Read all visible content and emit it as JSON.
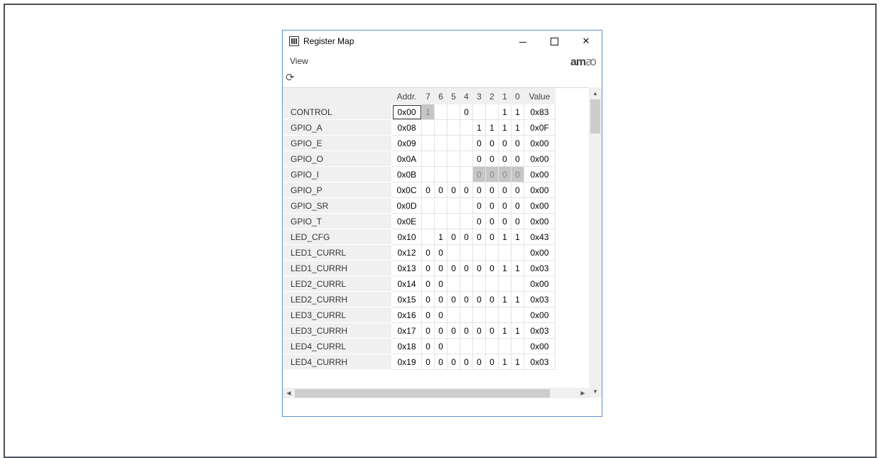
{
  "window": {
    "title": "Register Map",
    "min": "–",
    "max": "□",
    "close": "✕"
  },
  "menu": {
    "view": "View"
  },
  "logo": {
    "main": "am",
    "suffix": "ꜵ"
  },
  "table": {
    "headers": {
      "addr": "Addr.",
      "b7": "7",
      "b6": "6",
      "b5": "5",
      "b4": "4",
      "b3": "3",
      "b2": "2",
      "b1": "1",
      "b0": "0",
      "value": "Value"
    },
    "rows": [
      {
        "name": "CONTROL",
        "addr": "0x00",
        "bits": [
          "1",
          "",
          "",
          "0",
          "",
          "",
          "1",
          "1"
        ],
        "value": "0x83",
        "disabled": [
          0
        ]
      },
      {
        "name": "GPIO_A",
        "addr": "0x08",
        "bits": [
          "",
          "",
          "",
          "",
          "1",
          "1",
          "1",
          "1"
        ],
        "value": "0x0F",
        "disabled": []
      },
      {
        "name": "GPIO_E",
        "addr": "0x09",
        "bits": [
          "",
          "",
          "",
          "",
          "0",
          "0",
          "0",
          "0"
        ],
        "value": "0x00",
        "disabled": []
      },
      {
        "name": "GPIO_O",
        "addr": "0x0A",
        "bits": [
          "",
          "",
          "",
          "",
          "0",
          "0",
          "0",
          "0"
        ],
        "value": "0x00",
        "disabled": []
      },
      {
        "name": "GPIO_I",
        "addr": "0x0B",
        "bits": [
          "",
          "",
          "",
          "",
          "0",
          "0",
          "0",
          "0"
        ],
        "value": "0x00",
        "disabled": [
          4,
          5,
          6,
          7
        ]
      },
      {
        "name": "GPIO_P",
        "addr": "0x0C",
        "bits": [
          "0",
          "0",
          "0",
          "0",
          "0",
          "0",
          "0",
          "0"
        ],
        "value": "0x00",
        "disabled": []
      },
      {
        "name": "GPIO_SR",
        "addr": "0x0D",
        "bits": [
          "",
          "",
          "",
          "",
          "0",
          "0",
          "0",
          "0"
        ],
        "value": "0x00",
        "disabled": []
      },
      {
        "name": "GPIO_T",
        "addr": "0x0E",
        "bits": [
          "",
          "",
          "",
          "",
          "0",
          "0",
          "0",
          "0"
        ],
        "value": "0x00",
        "disabled": []
      },
      {
        "name": "LED_CFG",
        "addr": "0x10",
        "bits": [
          "",
          "1",
          "0",
          "0",
          "0",
          "0",
          "1",
          "1"
        ],
        "value": "0x43",
        "disabled": []
      },
      {
        "name": "LED1_CURRL",
        "addr": "0x12",
        "bits": [
          "0",
          "0",
          "",
          "",
          "",
          "",
          "",
          ""
        ],
        "value": "0x00",
        "disabled": []
      },
      {
        "name": "LED1_CURRH",
        "addr": "0x13",
        "bits": [
          "0",
          "0",
          "0",
          "0",
          "0",
          "0",
          "1",
          "1"
        ],
        "value": "0x03",
        "disabled": []
      },
      {
        "name": "LED2_CURRL",
        "addr": "0x14",
        "bits": [
          "0",
          "0",
          "",
          "",
          "",
          "",
          "",
          ""
        ],
        "value": "0x00",
        "disabled": []
      },
      {
        "name": "LED2_CURRH",
        "addr": "0x15",
        "bits": [
          "0",
          "0",
          "0",
          "0",
          "0",
          "0",
          "1",
          "1"
        ],
        "value": "0x03",
        "disabled": []
      },
      {
        "name": "LED3_CURRL",
        "addr": "0x16",
        "bits": [
          "0",
          "0",
          "",
          "",
          "",
          "",
          "",
          ""
        ],
        "value": "0x00",
        "disabled": []
      },
      {
        "name": "LED3_CURRH",
        "addr": "0x17",
        "bits": [
          "0",
          "0",
          "0",
          "0",
          "0",
          "0",
          "1",
          "1"
        ],
        "value": "0x03",
        "disabled": []
      },
      {
        "name": "LED4_CURRL",
        "addr": "0x18",
        "bits": [
          "0",
          "0",
          "",
          "",
          "",
          "",
          "",
          ""
        ],
        "value": "0x00",
        "disabled": []
      },
      {
        "name": "LED4_CURRH",
        "addr": "0x19",
        "bits": [
          "0",
          "0",
          "0",
          "0",
          "0",
          "0",
          "1",
          "1"
        ],
        "value": "0x03",
        "disabled": []
      }
    ]
  }
}
